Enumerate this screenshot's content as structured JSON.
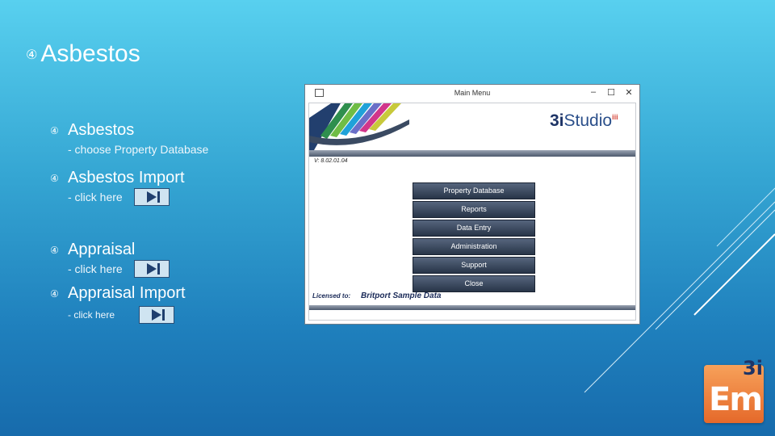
{
  "slide": {
    "title": "Asbestos",
    "bullet_glyph": "④",
    "items": [
      {
        "label": "Asbestos",
        "sub": "- choose Property Database"
      },
      {
        "label": "Asbestos Import",
        "sub": "- click here"
      },
      {
        "label": "Appraisal",
        "sub": "- click here"
      },
      {
        "label": "Appraisal Import",
        "sub": "- click here"
      }
    ]
  },
  "window": {
    "title": "Main Menu",
    "controls": [
      "–",
      "☐",
      "✕"
    ],
    "logo_prefix": "3i",
    "logo_suffix": "Studio",
    "logo_sup": "iii",
    "version": "V: 8.02.01.04",
    "menu": [
      "Property Database",
      "Reports",
      "Data Entry",
      "Administration",
      "Support",
      "Close"
    ],
    "licensed_label": "Licensed to:",
    "licensed_value": "Britport Sample Data"
  },
  "brand": {
    "em_text": "Em",
    "em_3i": "3i"
  },
  "colors": {
    "background_top": "#58d0ef",
    "background_bottom": "#176bac",
    "menu_button": "#3a475d",
    "em_orange": "#e5692a"
  },
  "icons": {
    "bullet": "numbered-circle-4",
    "play": "play-to-end-icon"
  }
}
